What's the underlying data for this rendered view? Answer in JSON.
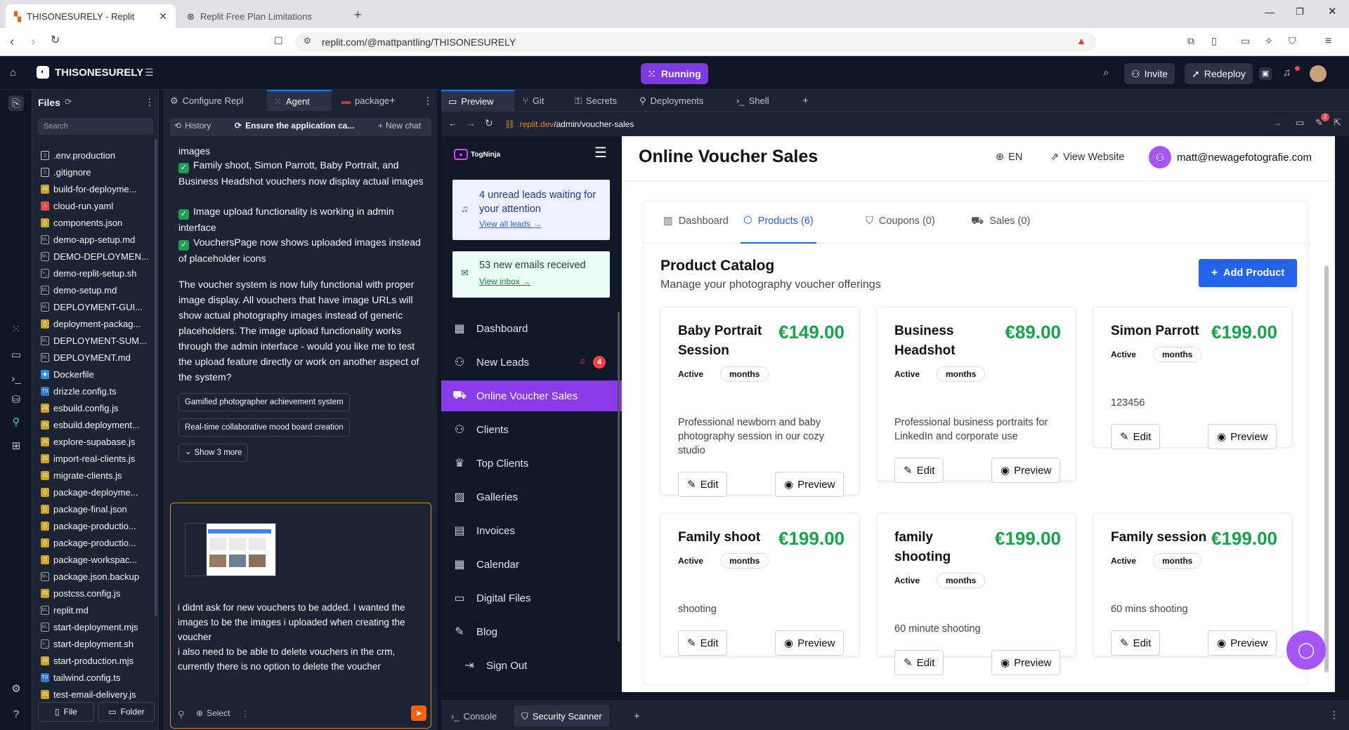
{
  "browser": {
    "tabs": [
      {
        "title": "THISONESURELY - Replit",
        "icon": "replit-icon"
      },
      {
        "title": "Replit Free Plan Limitations",
        "icon": "openai-icon"
      }
    ],
    "url": "replit.com/@mattpantling/THISONESURELY"
  },
  "header": {
    "project_name": "THISONESURELY",
    "run_status": "Running",
    "invite_label": "Invite",
    "redeploy_label": "Redeploy"
  },
  "files": {
    "title": "Files",
    "search_placeholder": "Search",
    "items": [
      {
        "name": ".env.production",
        "icon": "file"
      },
      {
        "name": ".gitignore",
        "icon": "file"
      },
      {
        "name": "build-for-deployme...",
        "icon": "js"
      },
      {
        "name": "cloud-run.yaml",
        "icon": "yaml"
      },
      {
        "name": "components.json",
        "icon": "json"
      },
      {
        "name": "demo-app-setup.md",
        "icon": "md"
      },
      {
        "name": "DEMO-DEPLOYMEN...",
        "icon": "md"
      },
      {
        "name": "demo-replit-setup.sh",
        "icon": "sh"
      },
      {
        "name": "demo-setup.md",
        "icon": "md"
      },
      {
        "name": "DEPLOYMENT-GUI...",
        "icon": "md"
      },
      {
        "name": "deployment-packag...",
        "icon": "json"
      },
      {
        "name": "DEPLOYMENT-SUM...",
        "icon": "md"
      },
      {
        "name": "DEPLOYMENT.md",
        "icon": "md"
      },
      {
        "name": "Dockerfile",
        "icon": "docker"
      },
      {
        "name": "drizzle.config.ts",
        "icon": "ts"
      },
      {
        "name": "esbuild.config.js",
        "icon": "js"
      },
      {
        "name": "esbuild.deployment...",
        "icon": "js"
      },
      {
        "name": "explore-supabase.js",
        "icon": "js"
      },
      {
        "name": "import-real-clients.js",
        "icon": "js"
      },
      {
        "name": "migrate-clients.js",
        "icon": "js"
      },
      {
        "name": "package-deployme...",
        "icon": "json"
      },
      {
        "name": "package-final.json",
        "icon": "json"
      },
      {
        "name": "package-productio...",
        "icon": "json"
      },
      {
        "name": "package-productio...",
        "icon": "json"
      },
      {
        "name": "package-workspac...",
        "icon": "json"
      },
      {
        "name": "package.json.backup",
        "icon": "md"
      },
      {
        "name": "postcss.config.js",
        "icon": "js"
      },
      {
        "name": "replit.md",
        "icon": "md"
      },
      {
        "name": "start-deployment.mjs",
        "icon": "md"
      },
      {
        "name": "start-deployment.sh",
        "icon": "sh"
      },
      {
        "name": "start-production.mjs",
        "icon": "js"
      },
      {
        "name": "tailwind.config.ts",
        "icon": "ts"
      },
      {
        "name": "test-email-delivery.js",
        "icon": "js"
      }
    ],
    "new_file_label": "File",
    "new_folder_label": "Folder"
  },
  "agent": {
    "tabs": [
      "Configure Repl",
      "Agent",
      "package"
    ],
    "history_label": "History",
    "thread_title": "Ensure the application ca...",
    "new_chat_label": "New chat",
    "msg_top": "images",
    "bullets": [
      "Family shoot, Simon Parrott, Baby Portrait, and Business Headshot vouchers now display actual images",
      "Image upload functionality is working in admin interface",
      "VouchersPage now shows uploaded images instead of placeholder icons"
    ],
    "summary": "The voucher system is now fully functional with proper image display. All vouchers that have image URLs will show actual photography images instead of generic placeholders. The image upload functionality works through the admin interface - would you like me to test the upload feature directly or work on another aspect of the system?",
    "suggestions": [
      "Gamified photographer achievement system",
      "Real-time collaborative mood board creation"
    ],
    "show_more": "Show 3 more",
    "input_text": "i didnt ask for new vouchers to be added. I wanted the images to be the images i uploaded when creating the voucher\ni also need to be able to delete vouchers in the crm, currently there is no option to delete the voucher",
    "select_label": "Select"
  },
  "preview": {
    "tabs": [
      "Preview",
      "Git",
      "Secrets",
      "Deployments",
      "Shell"
    ],
    "url_prefix": ".replit.dev",
    "url_path": "/admin/voucher-sales",
    "bottom_tabs": [
      "Console",
      "Security Scanner"
    ]
  },
  "app": {
    "brand": "TogNinja",
    "alert_leads": "4 unread leads waiting for your attention",
    "alert_leads_link": "View all leads →",
    "alert_emails": "53 new emails received",
    "alert_emails_link": "View inbox →",
    "nav": [
      {
        "label": "Dashboard",
        "icon": "dashboard-icon"
      },
      {
        "label": "New Leads",
        "icon": "user-plus-icon"
      },
      {
        "label": "Online Voucher Sales",
        "icon": "cart-icon"
      },
      {
        "label": "Clients",
        "icon": "users-icon"
      },
      {
        "label": "Top Clients",
        "icon": "crown-icon"
      },
      {
        "label": "Galleries",
        "icon": "image-icon"
      },
      {
        "label": "Invoices",
        "icon": "invoice-icon"
      },
      {
        "label": "Calendar",
        "icon": "calendar-icon"
      },
      {
        "label": "Digital Files",
        "icon": "folder-icon"
      },
      {
        "label": "Blog",
        "icon": "blog-icon"
      }
    ],
    "new_leads_count": "4",
    "sign_out": "Sign Out",
    "page_title": "Online Voucher Sales",
    "lang": "EN",
    "view_website": "View Website",
    "user_email": "matt@newagefotografie.com",
    "tabs": [
      "Dashboard",
      "Products (6)",
      "Coupons (0)",
      "Sales (0)"
    ],
    "catalog_title": "Product Catalog",
    "catalog_subtitle": "Manage your photography voucher offerings",
    "add_product": "Add Product",
    "active_label": "Active",
    "months_label": "months",
    "edit_label": "Edit",
    "preview_label": "Preview",
    "products": [
      {
        "title": "Baby Portrait Session",
        "price": "€149.00",
        "desc": "Professional newborn and baby photography session in our cozy studio"
      },
      {
        "title": "Business Headshot",
        "price": "€89.00",
        "desc": "Professional business portraits for LinkedIn and corporate use"
      },
      {
        "title": "Simon Parrott",
        "price": "€199.00",
        "desc": "123456"
      },
      {
        "title": "Family shoot",
        "price": "€199.00",
        "desc": "shooting"
      },
      {
        "title": "family shooting",
        "price": "€199.00",
        "desc": "60 minute shooting"
      },
      {
        "title": "Family session",
        "price": "€199.00",
        "desc": "60 mins shooting"
      }
    ]
  }
}
